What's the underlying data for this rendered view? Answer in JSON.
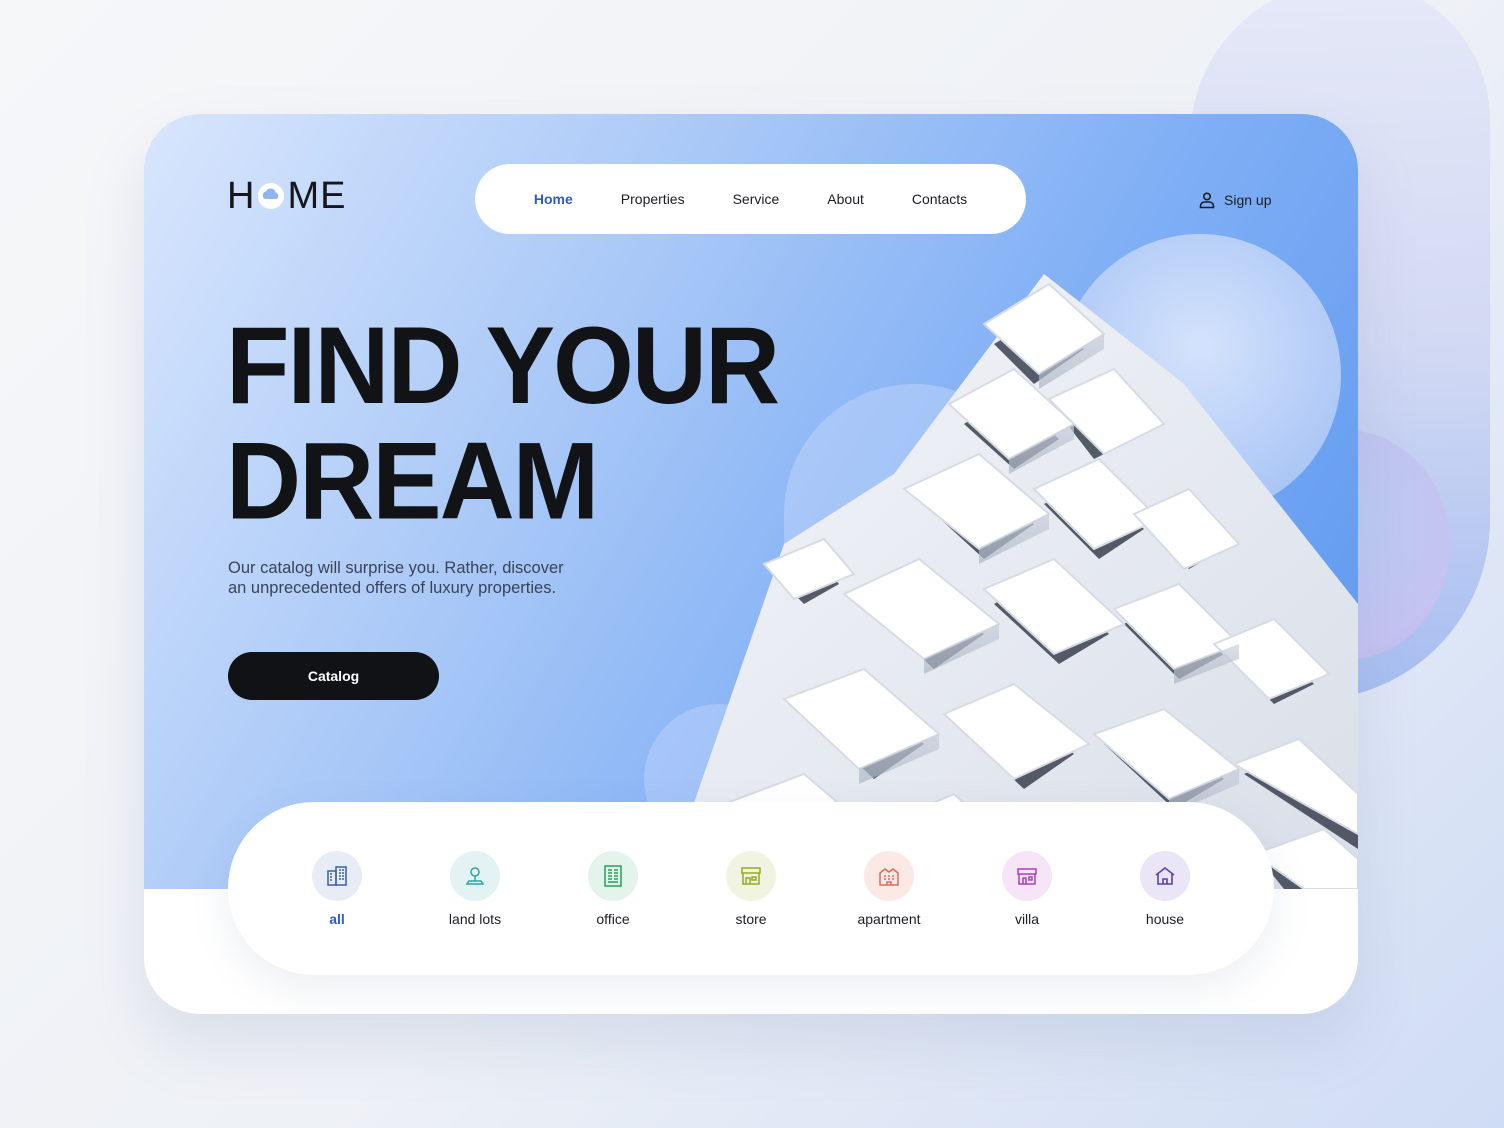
{
  "logo": {
    "text_left": "H",
    "text_right": "ME"
  },
  "nav": {
    "items": [
      {
        "label": "Home",
        "active": true
      },
      {
        "label": "Properties",
        "active": false
      },
      {
        "label": "Service",
        "active": false
      },
      {
        "label": "About",
        "active": false
      },
      {
        "label": "Contacts",
        "active": false
      }
    ]
  },
  "header": {
    "signup_label": "Sign up",
    "signup_icon": "user-icon"
  },
  "hero": {
    "headline_line1": "FIND YOUR",
    "headline_line2": "DREAM",
    "subtitle_line1": "Our catalog will surprise you. Rather, discover",
    "subtitle_line2": "an unprecedented offers of luxury properties.",
    "cta_label": "Catalog"
  },
  "categories": [
    {
      "label": "all",
      "icon": "building-icon",
      "color": "#3b5ea8",
      "bg": "#e7ecf6",
      "active": true
    },
    {
      "label": "land lots",
      "icon": "map-pin-icon",
      "color": "#2fa3a3",
      "bg": "#e3f3f3",
      "active": false
    },
    {
      "label": "office",
      "icon": "office-building-icon",
      "color": "#27a05a",
      "bg": "#e3f4ea",
      "active": false
    },
    {
      "label": "store",
      "icon": "store-icon",
      "color": "#9aa824",
      "bg": "#f1f4e1",
      "active": false
    },
    {
      "label": "apartment",
      "icon": "apartment-icon",
      "color": "#de6a5a",
      "bg": "#fbe9e6",
      "active": false
    },
    {
      "label": "villa",
      "icon": "villa-icon",
      "color": "#b03cbf",
      "bg": "#f5e5f7",
      "active": false
    },
    {
      "label": "house",
      "icon": "house-icon",
      "color": "#5a3fb8",
      "bg": "#ebe6f7",
      "active": false
    }
  ],
  "colors": {
    "accent": "#2f5cc0",
    "dark": "#111216",
    "hero_blue": "#5c96ef"
  }
}
